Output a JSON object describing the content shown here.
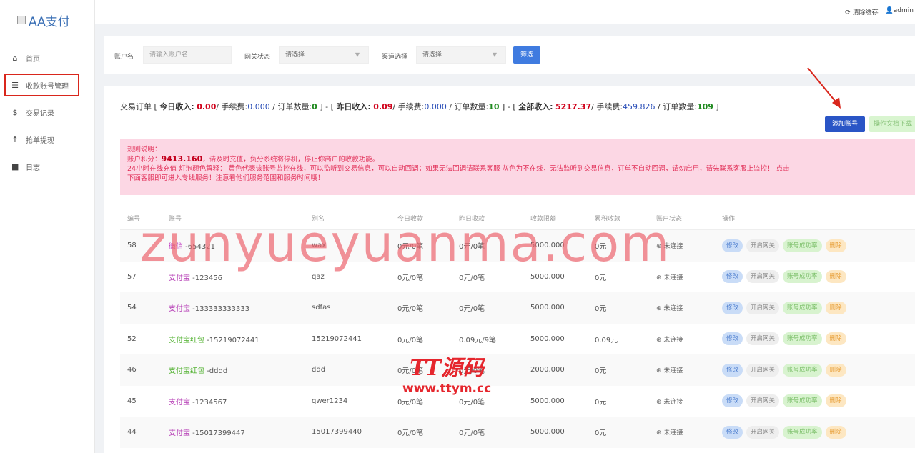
{
  "logo": {
    "text": "AA支付"
  },
  "nav": [
    {
      "label": "首页",
      "icon": "home-icon",
      "glyph": "⌂"
    },
    {
      "label": "收款账号管理",
      "icon": "list-icon",
      "glyph": "☰"
    },
    {
      "label": "交易记录",
      "icon": "dollar-icon",
      "glyph": "$"
    },
    {
      "label": "抢单提现",
      "icon": "upload-icon",
      "glyph": "↑"
    },
    {
      "label": "日志",
      "icon": "book-icon",
      "glyph": "■"
    }
  ],
  "topbar": {
    "clear_cache": "清除缓存",
    "user": "admin"
  },
  "filter": {
    "account_label": "账户名",
    "account_placeholder": "请输入账户名",
    "gateway_label": "网关状态",
    "gateway_value": "请选择",
    "channel_label": "渠道选择",
    "channel_value": "请选择",
    "submit": "筛选"
  },
  "summary": {
    "prefix": "交易订单 [ ",
    "today_label": "今日收入:",
    "today_income": "0.00",
    "today_fee_label": "/ 手续费:",
    "today_fee": "0.000",
    "today_count_label": " / 订单数量:",
    "today_count": "0",
    "sep1": " ] - [ ",
    "yesterday_label": "昨日收入:",
    "yesterday_income": "0.09",
    "yesterday_fee_label": "/ 手续费:",
    "yesterday_fee": "0.000",
    "yesterday_count_label": " / 订单数量:",
    "yesterday_count": "10",
    "sep2": " ] - [ ",
    "total_label": "全部收入:",
    "total_income": "5217.37",
    "total_fee_label": "/ 手续费:",
    "total_fee": "459.826",
    "total_count_label": " / 订单数量:",
    "total_count": "109",
    "suffix": " ]"
  },
  "buttons": {
    "add_account": "添加账号",
    "api_doc": "操作文档下载"
  },
  "notice": {
    "title": "规则说明：",
    "points_label": "账户积分：",
    "points": "9413.160",
    "points_rest": "，请及时充值，负分系统将停机，停止你商户的收款功能。",
    "line2": "24小时在线充值 灯泡颜色解释： 黄色代表该账号监控在线，可以监听到交易信息，可以自动回调；如果无法回调请联系客服 灰色为不在线，无法监听到交易信息，订单不自动回调，请勿启用，请先联系客服上监控！ 点击",
    "line3": "下面客服即可进入专线服务！注意看他们服务范围和服务时间哦！"
  },
  "table": {
    "headers": [
      "编号",
      "账号",
      "别名",
      "今日收款",
      "昨日收款",
      "收款限额",
      "累积收款",
      "账户状态",
      "操作"
    ],
    "rows": [
      {
        "id": "58",
        "type": "微信",
        "type_class": "acct-wx",
        "acct": " -654321",
        "alias": "wax",
        "today": "0元/0笔",
        "yesterday": "0元/0笔",
        "limit": "5000.000",
        "total": "0元",
        "status": "未连接"
      },
      {
        "id": "57",
        "type": "支付宝",
        "type_class": "acct-ali",
        "acct": " -123456",
        "alias": "qaz",
        "today": "0元/0笔",
        "yesterday": "0元/0笔",
        "limit": "5000.000",
        "total": "0元",
        "status": "未连接"
      },
      {
        "id": "54",
        "type": "支付宝",
        "type_class": "acct-ali",
        "acct": " -133333333333",
        "alias": "sdfas",
        "today": "0元/0笔",
        "yesterday": "0元/0笔",
        "limit": "5000.000",
        "total": "0元",
        "status": "未连接"
      },
      {
        "id": "52",
        "type": "支付宝红包",
        "type_class": "acct-hb",
        "acct": " -15219072441",
        "alias": "15219072441",
        "today": "0元/0笔",
        "yesterday": "0.09元/9笔",
        "limit": "5000.000",
        "total": "0.09元",
        "status": "未连接"
      },
      {
        "id": "46",
        "type": "支付宝红包",
        "type_class": "acct-hb",
        "acct": " -dddd",
        "alias": "ddd",
        "today": "0元/0笔",
        "yesterday": "0元/0笔",
        "limit": "2000.000",
        "total": "0元",
        "status": "未连接"
      },
      {
        "id": "45",
        "type": "支付宝",
        "type_class": "acct-ali",
        "acct": " -1234567",
        "alias": "qwer1234",
        "today": "0元/0笔",
        "yesterday": "0元/0笔",
        "limit": "5000.000",
        "total": "0元",
        "status": "未连接"
      },
      {
        "id": "44",
        "type": "支付宝",
        "type_class": "acct-ali",
        "acct": " -15017399447",
        "alias": "15017399440",
        "today": "0元/0笔",
        "yesterday": "0元/0笔",
        "limit": "5000.000",
        "total": "0元",
        "status": "未连接"
      }
    ],
    "actions": {
      "edit": "修改",
      "open": "开启网关",
      "rate": "账号成功率",
      "del": "删除"
    }
  },
  "watermark": {
    "text": "zunyueyuanma.com",
    "logo": "TT源码",
    "url": "www.ttym.cc"
  },
  "colors": {
    "primary": "#2a55c6",
    "notice_bg": "#fcd7e4",
    "annotation": "#d9261c"
  }
}
